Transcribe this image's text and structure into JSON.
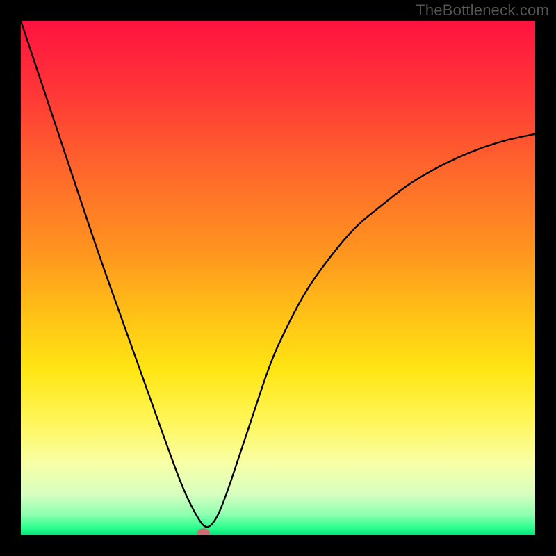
{
  "watermark": "TheBottleneck.com",
  "chart_data": {
    "type": "line",
    "title": "",
    "xlabel": "",
    "ylabel": "",
    "xlim": [
      0,
      100
    ],
    "ylim": [
      0,
      100
    ],
    "grid": false,
    "legend": false,
    "series": [
      {
        "name": "bottleneck-curve",
        "x": [
          0,
          5,
          10,
          15,
          20,
          25,
          30,
          32,
          34,
          36,
          38,
          40,
          42,
          44,
          46,
          48,
          50,
          55,
          60,
          65,
          70,
          75,
          80,
          85,
          90,
          95,
          100
        ],
        "values": [
          100,
          85,
          70,
          55,
          41,
          27,
          13,
          8,
          4,
          1,
          3,
          8,
          14,
          20,
          26,
          32,
          37,
          47,
          54,
          60,
          64,
          68,
          71,
          73.5,
          75.5,
          77,
          78
        ]
      }
    ],
    "marker": {
      "x": 35.5,
      "y": 0.5
    },
    "gradient_stops": [
      {
        "pos": 0,
        "color": "#ff1240"
      },
      {
        "pos": 0.45,
        "color": "#ff951f"
      },
      {
        "pos": 0.7,
        "color": "#ffe614"
      },
      {
        "pos": 0.92,
        "color": "#d7ffc0"
      },
      {
        "pos": 1.0,
        "color": "#00e778"
      }
    ]
  }
}
